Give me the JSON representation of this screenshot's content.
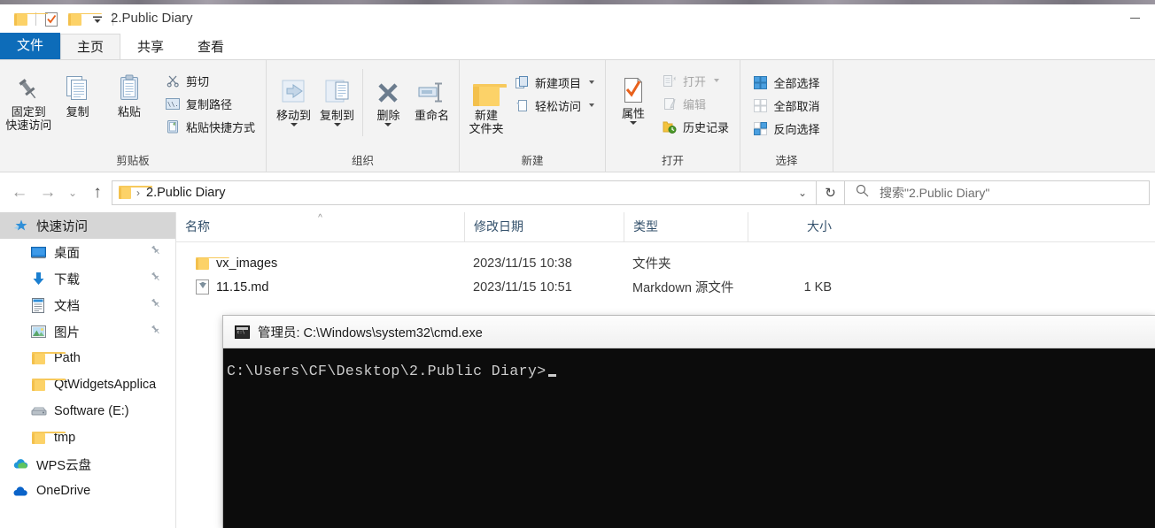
{
  "window": {
    "title": "2.Public Diary",
    "minimize_label": "—",
    "quick_access": [
      {
        "name": "folder-icon",
        "label": "folder"
      },
      {
        "name": "properties-icon",
        "label": "properties"
      },
      {
        "name": "new-folder-icon",
        "label": "new folder"
      },
      {
        "name": "chevron-down-icon",
        "label": "customize"
      }
    ]
  },
  "ribbon": {
    "tabs": [
      {
        "label": "文件",
        "type": "file"
      },
      {
        "label": "主页",
        "type": "tab",
        "active": true
      },
      {
        "label": "共享",
        "type": "tab",
        "active": false
      },
      {
        "label": "查看",
        "type": "tab",
        "active": false
      }
    ],
    "groups": [
      {
        "name": "剪贴板",
        "big": [
          {
            "label_line1": "固定到",
            "label_line2": "快速访问",
            "icon": "pin-icon"
          },
          {
            "label_line1": "复制",
            "label_line2": "",
            "icon": "copy-icon"
          },
          {
            "label_line1": "粘贴",
            "label_line2": "",
            "icon": "paste-icon"
          }
        ],
        "small": [
          {
            "label": "剪切",
            "icon": "scissors-icon",
            "disabled": false,
            "caret": false
          },
          {
            "label": "复制路径",
            "icon": "copy-path-icon",
            "disabled": false,
            "caret": false
          },
          {
            "label": "粘贴快捷方式",
            "icon": "paste-shortcut-icon",
            "disabled": false,
            "caret": false
          }
        ]
      },
      {
        "name": "组织",
        "big": [
          {
            "label_line1": "移动到",
            "label_line2": "",
            "icon": "move-to-icon",
            "caret": true
          },
          {
            "label_line1": "复制到",
            "label_line2": "",
            "icon": "copy-to-icon",
            "caret": true
          },
          {
            "label_line1": "删除",
            "label_line2": "",
            "icon": "delete-icon",
            "caret": true
          },
          {
            "label_line1": "重命名",
            "label_line2": "",
            "icon": "rename-icon",
            "caret": false
          }
        ],
        "small": []
      },
      {
        "name": "新建",
        "big": [
          {
            "label_line1": "新建",
            "label_line2": "文件夹",
            "icon": "new-folder-icon"
          }
        ],
        "small": [
          {
            "label": "新建项目",
            "icon": "new-item-icon",
            "disabled": false,
            "caret": true
          },
          {
            "label": "轻松访问",
            "icon": "easy-access-icon",
            "disabled": false,
            "caret": true
          }
        ]
      },
      {
        "name": "打开",
        "big": [
          {
            "label_line1": "属性",
            "label_line2": "",
            "icon": "properties-icon",
            "caret": true
          }
        ],
        "small": [
          {
            "label": "打开",
            "icon": "open-icon",
            "disabled": true,
            "caret": true
          },
          {
            "label": "编辑",
            "icon": "edit-icon",
            "disabled": true,
            "caret": false
          },
          {
            "label": "历史记录",
            "icon": "history-icon",
            "disabled": false,
            "caret": false
          }
        ]
      },
      {
        "name": "选择",
        "big": [],
        "small": [
          {
            "label": "全部选择",
            "icon": "select-all-icon",
            "disabled": false,
            "caret": false
          },
          {
            "label": "全部取消",
            "icon": "select-none-icon",
            "disabled": true,
            "caret": false
          },
          {
            "label": "反向选择",
            "icon": "invert-selection-icon",
            "disabled": false,
            "caret": false
          }
        ]
      }
    ]
  },
  "addressbar": {
    "back_label": "←",
    "forward_label": "→",
    "recent_label": "⌄",
    "up_label": "↑",
    "breadcrumb_sep": "›",
    "path_label": "2.Public Diary",
    "dropdown_label": "⌄",
    "refresh_label": "↻"
  },
  "search": {
    "icon": "search-icon",
    "placeholder": "搜索\"2.Public Diary\""
  },
  "sidebar": {
    "items": [
      {
        "label": "快速访问",
        "icon": "quick-access-star-icon",
        "selected": true,
        "indent": false,
        "pinned": false
      },
      {
        "label": "桌面",
        "icon": "desktop-icon",
        "selected": false,
        "indent": true,
        "pinned": true
      },
      {
        "label": "下载",
        "icon": "downloads-icon",
        "selected": false,
        "indent": true,
        "pinned": true
      },
      {
        "label": "文档",
        "icon": "documents-icon",
        "selected": false,
        "indent": true,
        "pinned": true
      },
      {
        "label": "图片",
        "icon": "pictures-icon",
        "selected": false,
        "indent": true,
        "pinned": true
      },
      {
        "label": "Path",
        "icon": "folder-icon",
        "selected": false,
        "indent": true,
        "pinned": false
      },
      {
        "label": "QtWidgetsApplica",
        "icon": "folder-icon",
        "selected": false,
        "indent": true,
        "pinned": false
      },
      {
        "label": "Software (E:)",
        "icon": "drive-icon",
        "selected": false,
        "indent": true,
        "pinned": false
      },
      {
        "label": "tmp",
        "icon": "folder-icon",
        "selected": false,
        "indent": true,
        "pinned": false
      },
      {
        "label": "WPS云盘",
        "icon": "wps-cloud-icon",
        "selected": false,
        "indent": false,
        "pinned": false
      },
      {
        "label": "OneDrive",
        "icon": "onedrive-icon",
        "selected": false,
        "indent": false,
        "pinned": false
      }
    ]
  },
  "filelist": {
    "columns": [
      {
        "label": "名称",
        "key": "name",
        "sorted": true,
        "sort_glyph": "^"
      },
      {
        "label": "修改日期",
        "key": "date",
        "sorted": false,
        "sort_glyph": ""
      },
      {
        "label": "类型",
        "key": "type",
        "sorted": false,
        "sort_glyph": ""
      },
      {
        "label": "大小",
        "key": "size",
        "sorted": false,
        "sort_glyph": ""
      }
    ],
    "rows": [
      {
        "name": "vx_images",
        "date": "2023/11/15 10:38",
        "type": "文件夹",
        "size": "",
        "icon": "folder-icon"
      },
      {
        "name": "11.15.md",
        "date": "2023/11/15 10:51",
        "type": "Markdown 源文件",
        "size": "1 KB",
        "icon": "markdown-file-icon"
      }
    ]
  },
  "cmd": {
    "title": "管理员: C:\\Windows\\system32\\cmd.exe",
    "icon": "cmd-icon",
    "prompt": "C:\\Users\\CF\\Desktop\\2.Public Diary>"
  },
  "colors": {
    "accent": "#0d6cb9",
    "ribbon_bg": "#f3f3f3",
    "selected_nav": "#d6d6d6",
    "cmd_bg": "#0c0c0c",
    "cmd_fg": "#cccccc",
    "column_header_text": "#33506b"
  }
}
